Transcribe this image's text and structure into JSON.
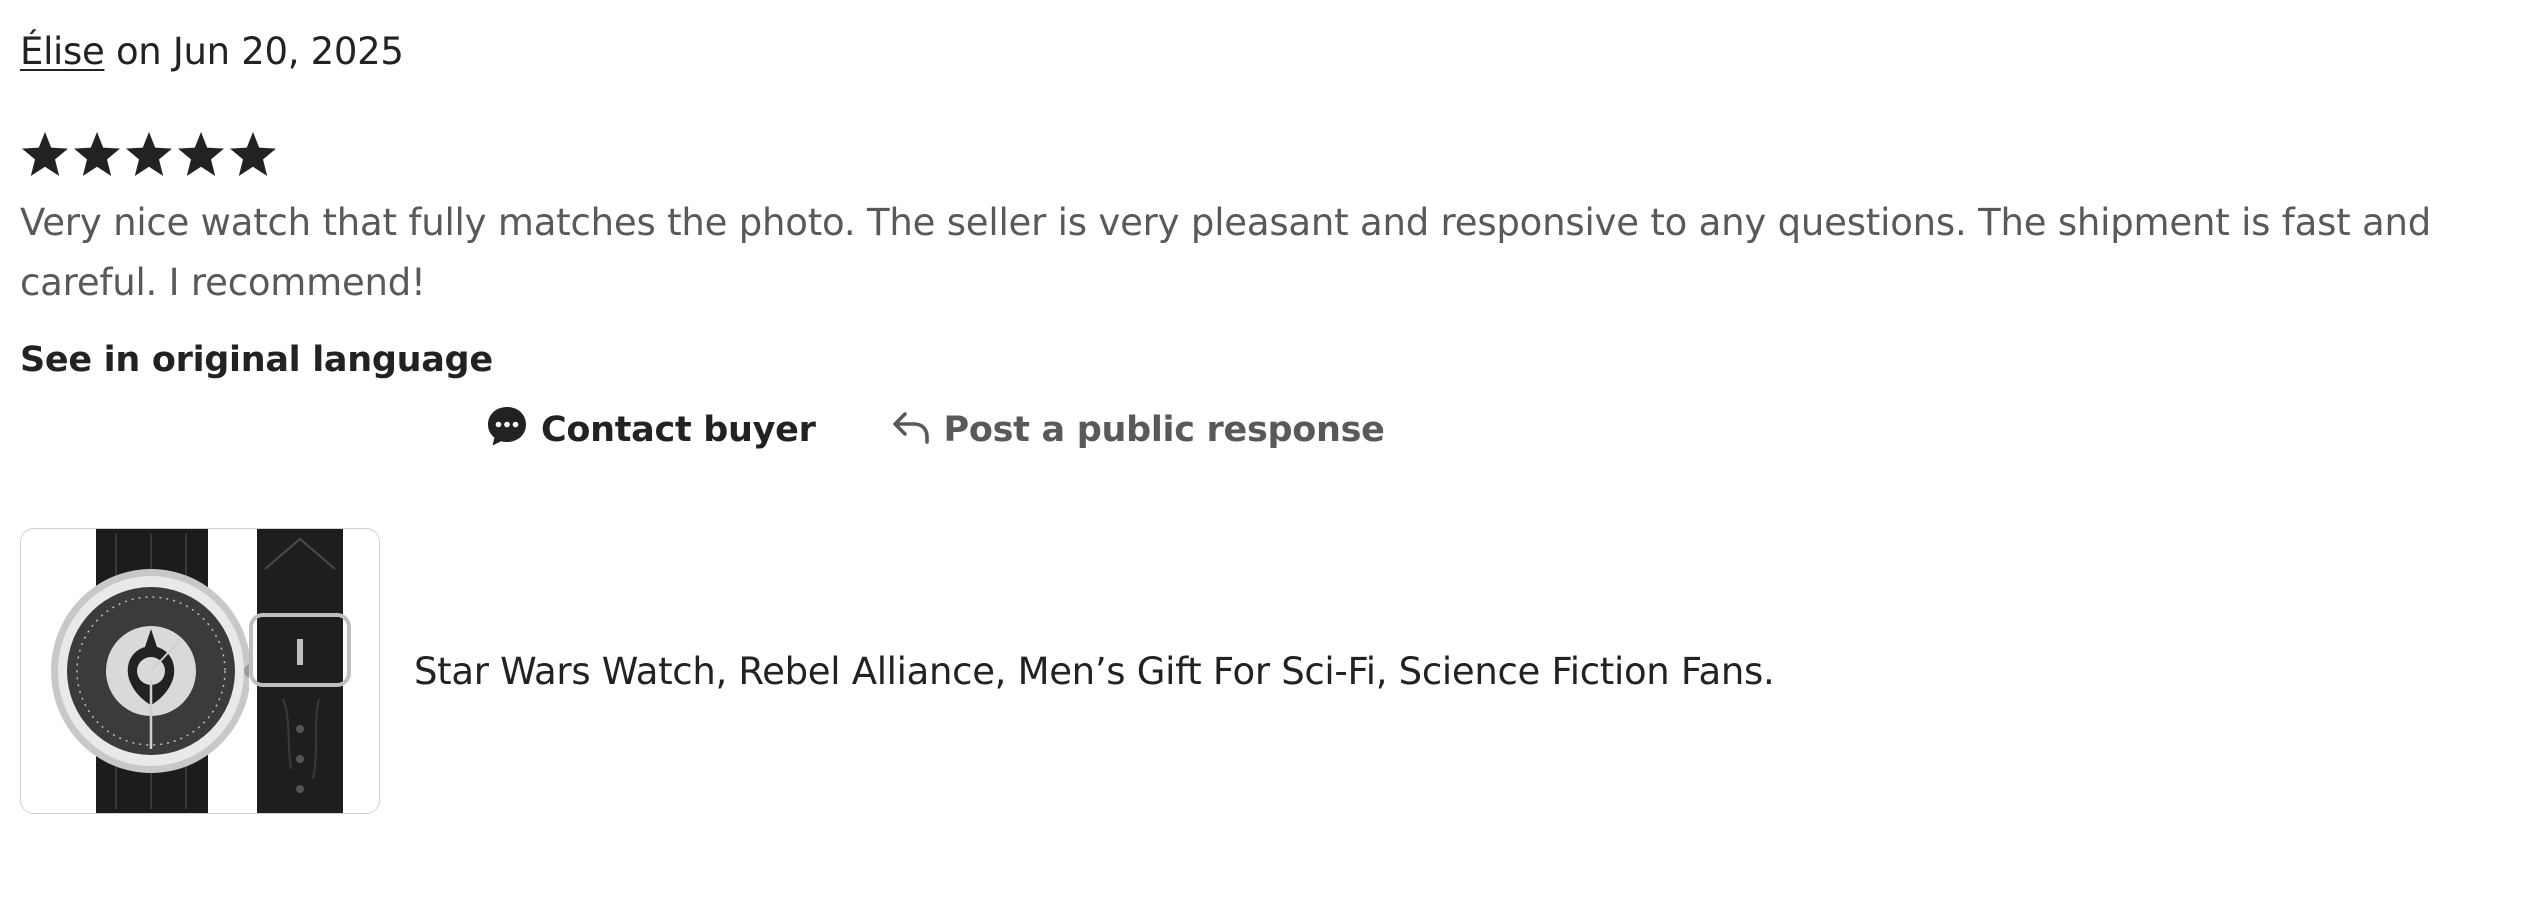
{
  "review": {
    "reviewer_name": "Élise",
    "date_text": " on Jun 20, 2025",
    "rating": 5,
    "rating_max": 5,
    "text": "Very nice watch that fully matches the photo. The seller is very pleasant and responsive to any questions. The shipment is fast and careful. I recommend!",
    "translate_link": "See in original language"
  },
  "actions": {
    "contact_label": "Contact buyer",
    "contact_icon": "chat-bubble-icon",
    "respond_label": "Post a public response",
    "respond_icon": "reply-arrow-icon"
  },
  "product": {
    "title": "Star Wars Watch, Rebel Alliance, Men’s Gift For Sci-Fi, Science Fiction Fans.",
    "image_icon": "product-thumbnail"
  },
  "colors": {
    "text_primary": "#222222",
    "text_secondary": "#595959",
    "border": "#cfcfcf"
  }
}
